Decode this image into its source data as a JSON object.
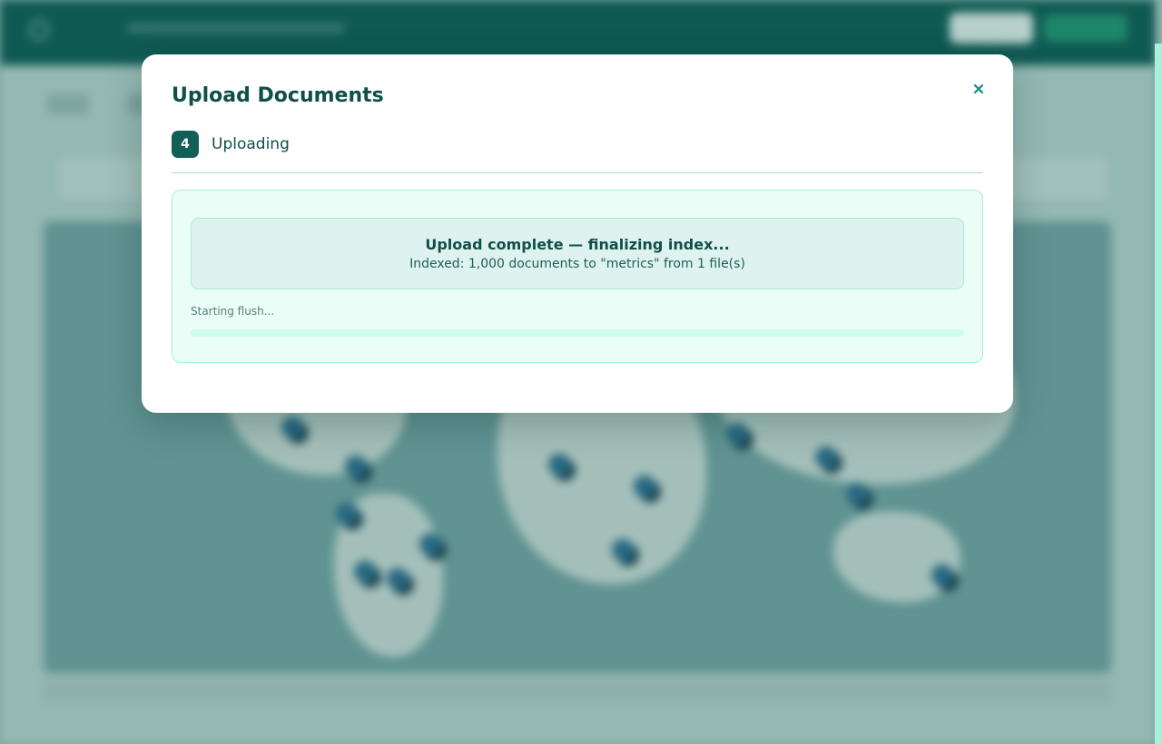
{
  "modal": {
    "title": "Upload Documents",
    "close_icon": "close-icon",
    "step": {
      "number": "4",
      "label": "Uploading"
    },
    "status": {
      "title": "Upload complete — finalizing index...",
      "detail": "Indexed: 1,000 documents to \"metrics\" from 1 file(s)"
    },
    "progress": {
      "text": "Starting flush...",
      "fraction": 0
    }
  },
  "colors": {
    "primary": "#115f57",
    "accent": "#0f8f83",
    "panel_bg": "#eafdf7",
    "panel_border": "#a7efdc"
  }
}
